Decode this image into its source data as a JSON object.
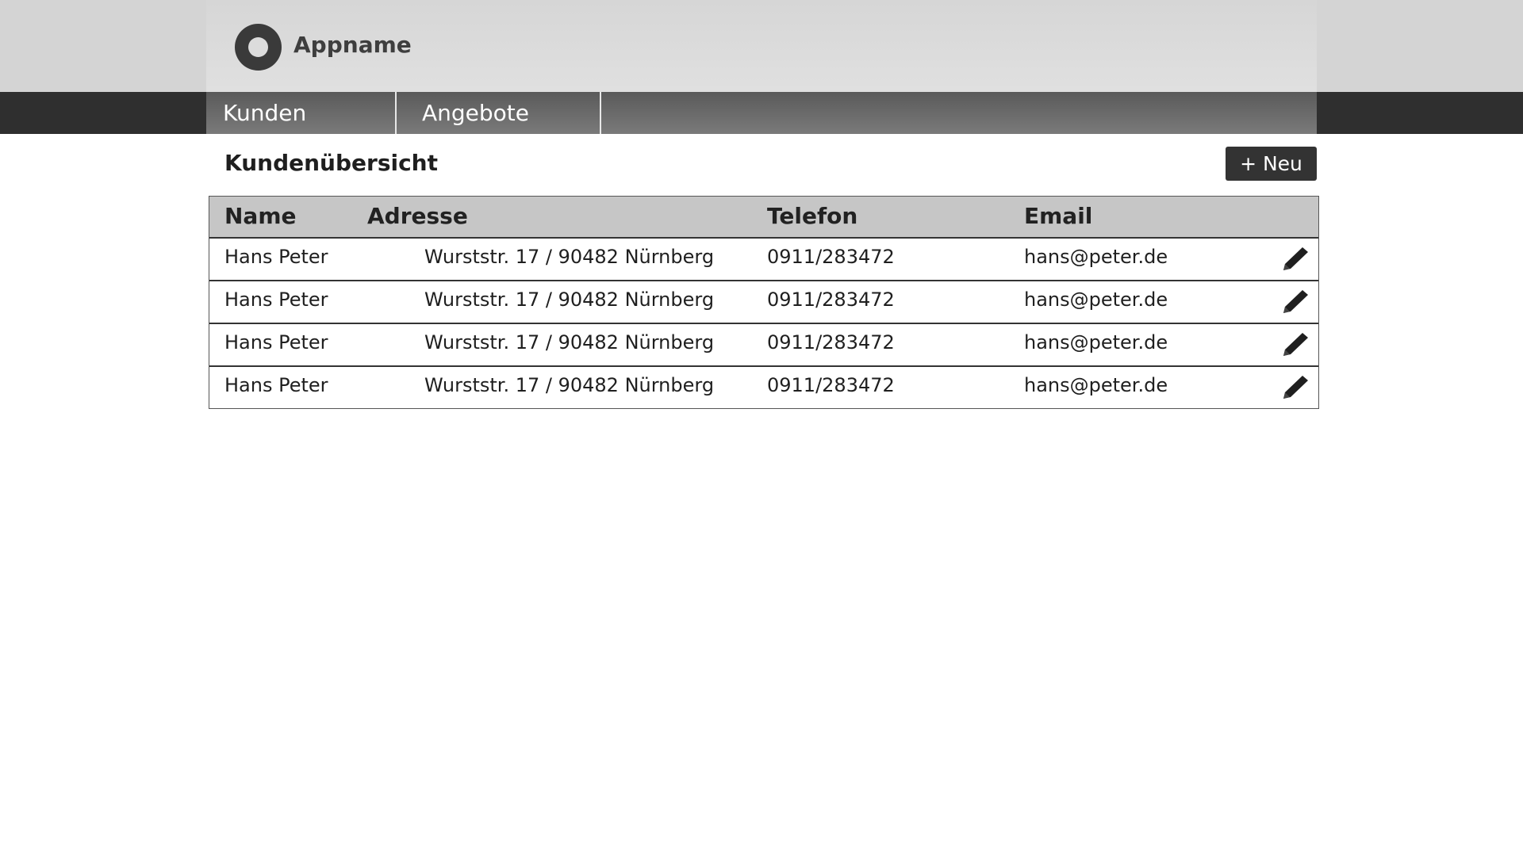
{
  "app": {
    "name": "Appname"
  },
  "nav": {
    "tabs": [
      {
        "label": "Kunden"
      },
      {
        "label": "Angebote"
      }
    ]
  },
  "page": {
    "title": "Kundenübersicht",
    "new_button": "+ Neu"
  },
  "table": {
    "headers": {
      "name": "Name",
      "address": "Adresse",
      "phone": "Telefon",
      "email": "Email"
    },
    "rows": [
      {
        "name": "Hans Peter",
        "address": "Wurststr. 17 / 90482 Nürnberg",
        "phone": "0911/283472",
        "email": "hans@peter.de",
        "action_icon": "pencil-icon"
      },
      {
        "name": "Hans Peter",
        "address": "Wurststr. 17 / 90482 Nürnberg",
        "phone": "0911/283472",
        "email": "hans@peter.de",
        "action_icon": "pencil-icon"
      },
      {
        "name": "Hans Peter",
        "address": "Wurststr. 17 / 90482 Nürnberg",
        "phone": "0911/283472",
        "email": "hans@peter.de",
        "action_icon": "pencil-icon"
      },
      {
        "name": "Hans Peter",
        "address": "Wurststr. 17 / 90482 Nürnberg",
        "phone": "0911/283472",
        "email": "hans@peter.de",
        "action_icon": "pencil-icon"
      }
    ]
  },
  "colors": {
    "header_bg": "#d4d4d4",
    "nav_bg": "#2f2f2f",
    "button_bg": "#333333",
    "table_header_bg": "#c6c6c6"
  }
}
